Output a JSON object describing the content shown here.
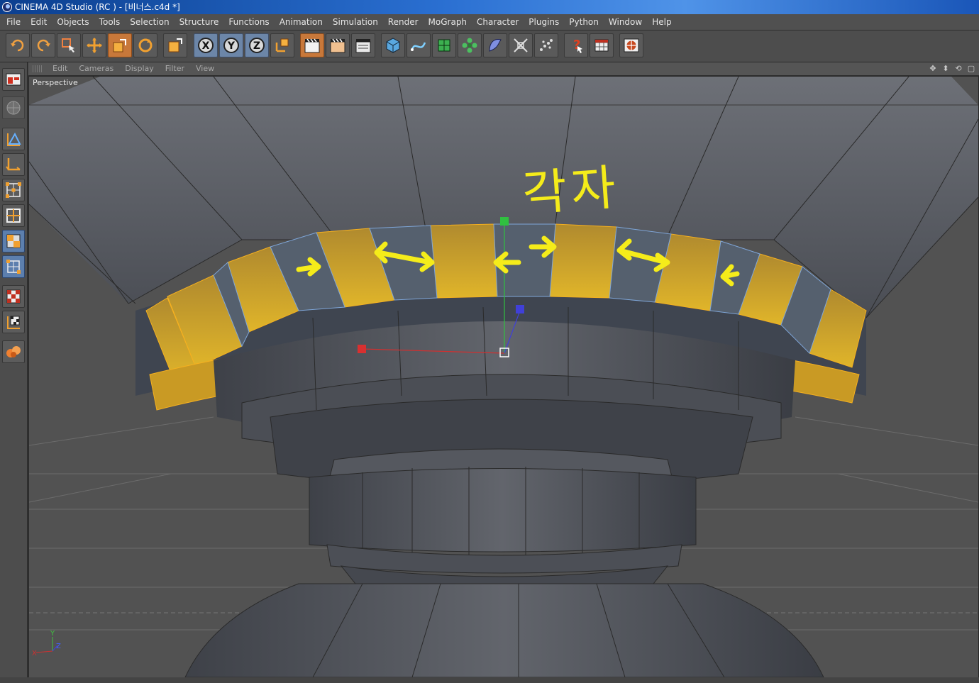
{
  "window": {
    "title": "CINEMA 4D Studio (RC ) - [비너스.c4d *]"
  },
  "menu": [
    "File",
    "Edit",
    "Objects",
    "Tools",
    "Selection",
    "Structure",
    "Functions",
    "Animation",
    "Simulation",
    "Render",
    "MoGraph",
    "Character",
    "Plugins",
    "Python",
    "Window",
    "Help"
  ],
  "toolbar": {
    "buttons": [
      {
        "name": "undo-icon"
      },
      {
        "name": "redo-icon"
      },
      {
        "name": "live-selection-icon"
      },
      {
        "name": "move-icon"
      },
      {
        "name": "scale-icon"
      },
      {
        "name": "rotate-icon"
      },
      {
        "name": "last-tool-icon"
      },
      {
        "name": "x-axis-icon",
        "label": "X"
      },
      {
        "name": "y-axis-icon",
        "label": "Y"
      },
      {
        "name": "z-axis-icon",
        "label": "Z"
      },
      {
        "name": "coordinate-system-icon"
      },
      {
        "name": "render-view-icon"
      },
      {
        "name": "render-picture-viewer-icon"
      },
      {
        "name": "render-settings-icon"
      },
      {
        "name": "cube-icon"
      },
      {
        "name": "spline-icon"
      },
      {
        "name": "nurbs-icon"
      },
      {
        "name": "array-icon"
      },
      {
        "name": "deformer-icon"
      },
      {
        "name": "scene-icon"
      },
      {
        "name": "particle-icon"
      },
      {
        "name": "help-icon"
      },
      {
        "name": "layout-icon"
      },
      {
        "name": "browser-icon"
      }
    ]
  },
  "viewport": {
    "menu": [
      "Edit",
      "Cameras",
      "Display",
      "Filter",
      "View"
    ],
    "label": "Perspective",
    "annotation": "각자",
    "axis_labels": {
      "y": "Y",
      "z": "Z",
      "x": "X"
    }
  },
  "colors": {
    "accent_orange": "#c8783a",
    "selection_yellow": "#d4a020",
    "annotation_yellow": "#f5ec1a"
  }
}
